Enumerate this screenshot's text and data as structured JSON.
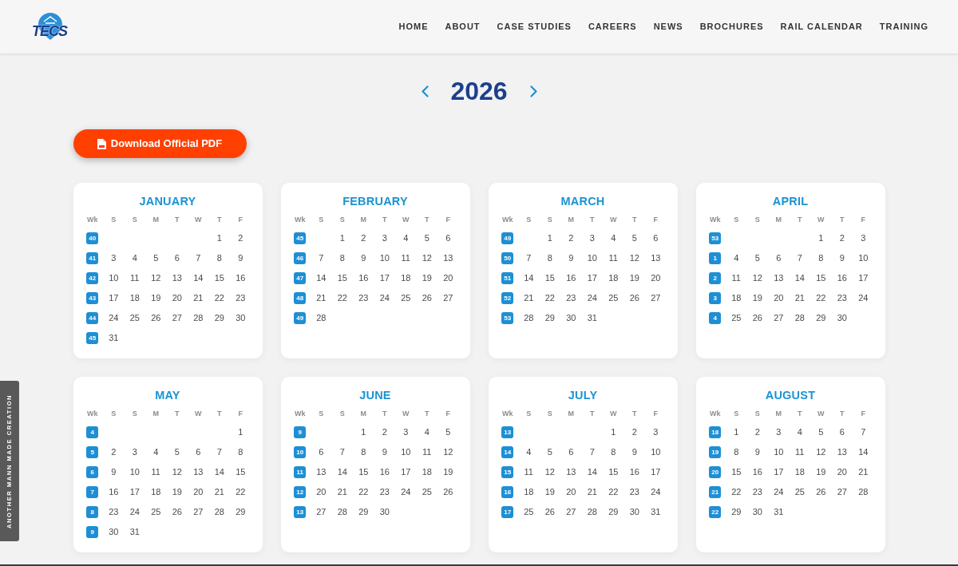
{
  "header": {
    "logo": {
      "text": "TECS"
    },
    "nav": [
      "HOME",
      "ABOUT",
      "CASE STUDIES",
      "CAREERS",
      "NEWS",
      "BROCHURES",
      "RAIL CALENDAR",
      "TRAINING"
    ]
  },
  "year_nav": {
    "year": "2026"
  },
  "download_button": {
    "label": "Download Official PDF"
  },
  "calendar": {
    "months": [
      {
        "name": "JANUARY",
        "headers": [
          "Wk",
          "S",
          "S",
          "M",
          "T",
          "W",
          "T",
          "F"
        ],
        "weeks": [
          {
            "number": "40",
            "days": [
              "1",
              "2"
            ]
          },
          {
            "number": "41",
            "days": [
              "3",
              "4",
              "5",
              "6",
              "7",
              "8",
              "9"
            ]
          },
          {
            "number": "42",
            "days": [
              "10",
              "11",
              "12",
              "13",
              "14",
              "15",
              "16"
            ]
          },
          {
            "number": "43",
            "days": [
              "17",
              "18",
              "19",
              "20",
              "21",
              "22",
              "23"
            ]
          },
          {
            "number": "44",
            "days": [
              "24",
              "25",
              "26",
              "27",
              "28",
              "29",
              "30"
            ]
          },
          {
            "number": "45",
            "days": [
              "31"
            ]
          }
        ]
      },
      {
        "name": "FEBRUARY",
        "headers": [
          "Wk",
          "S",
          "S",
          "M",
          "T",
          "W",
          "T",
          "F"
        ],
        "weeks": [
          {
            "number": "45",
            "days": [
              "1",
              "2",
              "3",
              "4",
              "5",
              "6"
            ]
          },
          {
            "number": "46",
            "days": [
              "7",
              "8",
              "9",
              "10",
              "11",
              "12",
              "13"
            ]
          },
          {
            "number": "47",
            "days": [
              "14",
              "15",
              "16",
              "17",
              "18",
              "19",
              "20"
            ]
          },
          {
            "number": "48",
            "days": [
              "21",
              "22",
              "23",
              "24",
              "25",
              "26",
              "27"
            ]
          },
          {
            "number": "49",
            "days": [
              "28"
            ]
          }
        ]
      },
      {
        "name": "MARCH",
        "headers": [
          "Wk",
          "S",
          "S",
          "M",
          "T",
          "W",
          "T",
          "F"
        ],
        "weeks": [
          {
            "number": "49",
            "days": [
              "1",
              "2",
              "3",
              "4",
              "5",
              "6"
            ]
          },
          {
            "number": "50",
            "days": [
              "7",
              "8",
              "9",
              "10",
              "11",
              "12",
              "13"
            ]
          },
          {
            "number": "51",
            "days": [
              "14",
              "15",
              "16",
              "17",
              "18",
              "19",
              "20"
            ]
          },
          {
            "number": "52",
            "days": [
              "21",
              "22",
              "23",
              "24",
              "25",
              "26",
              "27"
            ]
          },
          {
            "number": "53",
            "days": [
              "28",
              "29",
              "30",
              "31"
            ]
          }
        ]
      },
      {
        "name": "APRIL",
        "headers": [
          "Wk",
          "S",
          "S",
          "M",
          "T",
          "W",
          "T",
          "F"
        ],
        "weeks": [
          {
            "number": "53",
            "days": [
              "1",
              "2",
              "3"
            ]
          },
          {
            "number": "1",
            "days": [
              "4",
              "5",
              "6",
              "7",
              "8",
              "9",
              "10"
            ]
          },
          {
            "number": "2",
            "days": [
              "11",
              "12",
              "13",
              "14",
              "15",
              "16",
              "17"
            ]
          },
          {
            "number": "3",
            "days": [
              "18",
              "19",
              "20",
              "21",
              "22",
              "23",
              "24"
            ]
          },
          {
            "number": "4",
            "days": [
              "25",
              "26",
              "27",
              "28",
              "29",
              "30"
            ]
          }
        ]
      },
      {
        "name": "MAY",
        "headers": [
          "Wk",
          "S",
          "S",
          "M",
          "T",
          "W",
          "T",
          "F"
        ],
        "weeks": [
          {
            "number": "4",
            "days": [
              "1"
            ]
          },
          {
            "number": "5",
            "days": [
              "2",
              "3",
              "4",
              "5",
              "6",
              "7",
              "8"
            ]
          },
          {
            "number": "6",
            "days": [
              "9",
              "10",
              "11",
              "12",
              "13",
              "14",
              "15"
            ]
          },
          {
            "number": "7",
            "days": [
              "16",
              "17",
              "18",
              "19",
              "20",
              "21",
              "22"
            ]
          },
          {
            "number": "8",
            "days": [
              "23",
              "24",
              "25",
              "26",
              "27",
              "28",
              "29"
            ]
          },
          {
            "number": "9",
            "days": [
              "30",
              "31"
            ]
          }
        ]
      },
      {
        "name": "JUNE",
        "headers": [
          "Wk",
          "S",
          "S",
          "M",
          "T",
          "W",
          "T",
          "F"
        ],
        "weeks": [
          {
            "number": "9",
            "days": [
              "1",
              "2",
              "3",
              "4",
              "5"
            ]
          },
          {
            "number": "10",
            "days": [
              "6",
              "7",
              "8",
              "9",
              "10",
              "11",
              "12"
            ]
          },
          {
            "number": "11",
            "days": [
              "13",
              "14",
              "15",
              "16",
              "17",
              "18",
              "19"
            ]
          },
          {
            "number": "12",
            "days": [
              "20",
              "21",
              "22",
              "23",
              "24",
              "25",
              "26"
            ]
          },
          {
            "number": "13",
            "days": [
              "27",
              "28",
              "29",
              "30"
            ]
          }
        ]
      },
      {
        "name": "JULY",
        "headers": [
          "Wk",
          "S",
          "S",
          "M",
          "T",
          "W",
          "T",
          "F"
        ],
        "weeks": [
          {
            "number": "13",
            "days": [
              "1",
              "2",
              "3"
            ]
          },
          {
            "number": "14",
            "days": [
              "4",
              "5",
              "6",
              "7",
              "8",
              "9",
              "10"
            ]
          },
          {
            "number": "15",
            "days": [
              "11",
              "12",
              "13",
              "14",
              "15",
              "16",
              "17"
            ]
          },
          {
            "number": "16",
            "days": [
              "18",
              "19",
              "20",
              "21",
              "22",
              "23",
              "24"
            ]
          },
          {
            "number": "17",
            "days": [
              "25",
              "26",
              "27",
              "28",
              "29",
              "30",
              "31"
            ]
          }
        ]
      },
      {
        "name": "AUGUST",
        "headers": [
          "Wk",
          "S",
          "S",
          "M",
          "T",
          "W",
          "T",
          "F"
        ],
        "weeks": [
          {
            "number": "18",
            "days": [
              "1",
              "2",
              "3",
              "4",
              "5",
              "6",
              "7"
            ]
          },
          {
            "number": "19",
            "days": [
              "8",
              "9",
              "10",
              "11",
              "12",
              "13",
              "14"
            ]
          },
          {
            "number": "20",
            "days": [
              "15",
              "16",
              "17",
              "18",
              "19",
              "20",
              "21"
            ]
          },
          {
            "number": "21",
            "days": [
              "22",
              "23",
              "24",
              "25",
              "26",
              "27",
              "28"
            ]
          },
          {
            "number": "22",
            "days": [
              "29",
              "30",
              "31"
            ]
          }
        ]
      }
    ]
  },
  "side_tab": {
    "text": "ANOTHER MANN MADE CREATION"
  }
}
